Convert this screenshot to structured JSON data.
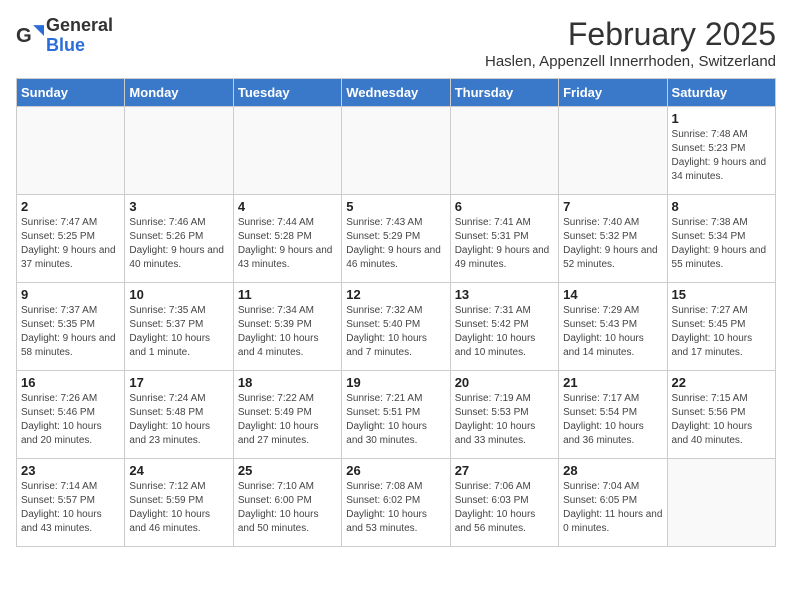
{
  "logo": {
    "general": "General",
    "blue": "Blue"
  },
  "header": {
    "title": "February 2025",
    "subtitle": "Haslen, Appenzell Innerrhoden, Switzerland"
  },
  "weekdays": [
    "Sunday",
    "Monday",
    "Tuesday",
    "Wednesday",
    "Thursday",
    "Friday",
    "Saturday"
  ],
  "weeks": [
    [
      {
        "day": "",
        "info": ""
      },
      {
        "day": "",
        "info": ""
      },
      {
        "day": "",
        "info": ""
      },
      {
        "day": "",
        "info": ""
      },
      {
        "day": "",
        "info": ""
      },
      {
        "day": "",
        "info": ""
      },
      {
        "day": "1",
        "info": "Sunrise: 7:48 AM\nSunset: 5:23 PM\nDaylight: 9 hours and 34 minutes."
      }
    ],
    [
      {
        "day": "2",
        "info": "Sunrise: 7:47 AM\nSunset: 5:25 PM\nDaylight: 9 hours and 37 minutes."
      },
      {
        "day": "3",
        "info": "Sunrise: 7:46 AM\nSunset: 5:26 PM\nDaylight: 9 hours and 40 minutes."
      },
      {
        "day": "4",
        "info": "Sunrise: 7:44 AM\nSunset: 5:28 PM\nDaylight: 9 hours and 43 minutes."
      },
      {
        "day": "5",
        "info": "Sunrise: 7:43 AM\nSunset: 5:29 PM\nDaylight: 9 hours and 46 minutes."
      },
      {
        "day": "6",
        "info": "Sunrise: 7:41 AM\nSunset: 5:31 PM\nDaylight: 9 hours and 49 minutes."
      },
      {
        "day": "7",
        "info": "Sunrise: 7:40 AM\nSunset: 5:32 PM\nDaylight: 9 hours and 52 minutes."
      },
      {
        "day": "8",
        "info": "Sunrise: 7:38 AM\nSunset: 5:34 PM\nDaylight: 9 hours and 55 minutes."
      }
    ],
    [
      {
        "day": "9",
        "info": "Sunrise: 7:37 AM\nSunset: 5:35 PM\nDaylight: 9 hours and 58 minutes."
      },
      {
        "day": "10",
        "info": "Sunrise: 7:35 AM\nSunset: 5:37 PM\nDaylight: 10 hours and 1 minute."
      },
      {
        "day": "11",
        "info": "Sunrise: 7:34 AM\nSunset: 5:39 PM\nDaylight: 10 hours and 4 minutes."
      },
      {
        "day": "12",
        "info": "Sunrise: 7:32 AM\nSunset: 5:40 PM\nDaylight: 10 hours and 7 minutes."
      },
      {
        "day": "13",
        "info": "Sunrise: 7:31 AM\nSunset: 5:42 PM\nDaylight: 10 hours and 10 minutes."
      },
      {
        "day": "14",
        "info": "Sunrise: 7:29 AM\nSunset: 5:43 PM\nDaylight: 10 hours and 14 minutes."
      },
      {
        "day": "15",
        "info": "Sunrise: 7:27 AM\nSunset: 5:45 PM\nDaylight: 10 hours and 17 minutes."
      }
    ],
    [
      {
        "day": "16",
        "info": "Sunrise: 7:26 AM\nSunset: 5:46 PM\nDaylight: 10 hours and 20 minutes."
      },
      {
        "day": "17",
        "info": "Sunrise: 7:24 AM\nSunset: 5:48 PM\nDaylight: 10 hours and 23 minutes."
      },
      {
        "day": "18",
        "info": "Sunrise: 7:22 AM\nSunset: 5:49 PM\nDaylight: 10 hours and 27 minutes."
      },
      {
        "day": "19",
        "info": "Sunrise: 7:21 AM\nSunset: 5:51 PM\nDaylight: 10 hours and 30 minutes."
      },
      {
        "day": "20",
        "info": "Sunrise: 7:19 AM\nSunset: 5:53 PM\nDaylight: 10 hours and 33 minutes."
      },
      {
        "day": "21",
        "info": "Sunrise: 7:17 AM\nSunset: 5:54 PM\nDaylight: 10 hours and 36 minutes."
      },
      {
        "day": "22",
        "info": "Sunrise: 7:15 AM\nSunset: 5:56 PM\nDaylight: 10 hours and 40 minutes."
      }
    ],
    [
      {
        "day": "23",
        "info": "Sunrise: 7:14 AM\nSunset: 5:57 PM\nDaylight: 10 hours and 43 minutes."
      },
      {
        "day": "24",
        "info": "Sunrise: 7:12 AM\nSunset: 5:59 PM\nDaylight: 10 hours and 46 minutes."
      },
      {
        "day": "25",
        "info": "Sunrise: 7:10 AM\nSunset: 6:00 PM\nDaylight: 10 hours and 50 minutes."
      },
      {
        "day": "26",
        "info": "Sunrise: 7:08 AM\nSunset: 6:02 PM\nDaylight: 10 hours and 53 minutes."
      },
      {
        "day": "27",
        "info": "Sunrise: 7:06 AM\nSunset: 6:03 PM\nDaylight: 10 hours and 56 minutes."
      },
      {
        "day": "28",
        "info": "Sunrise: 7:04 AM\nSunset: 6:05 PM\nDaylight: 11 hours and 0 minutes."
      },
      {
        "day": "",
        "info": ""
      }
    ]
  ]
}
